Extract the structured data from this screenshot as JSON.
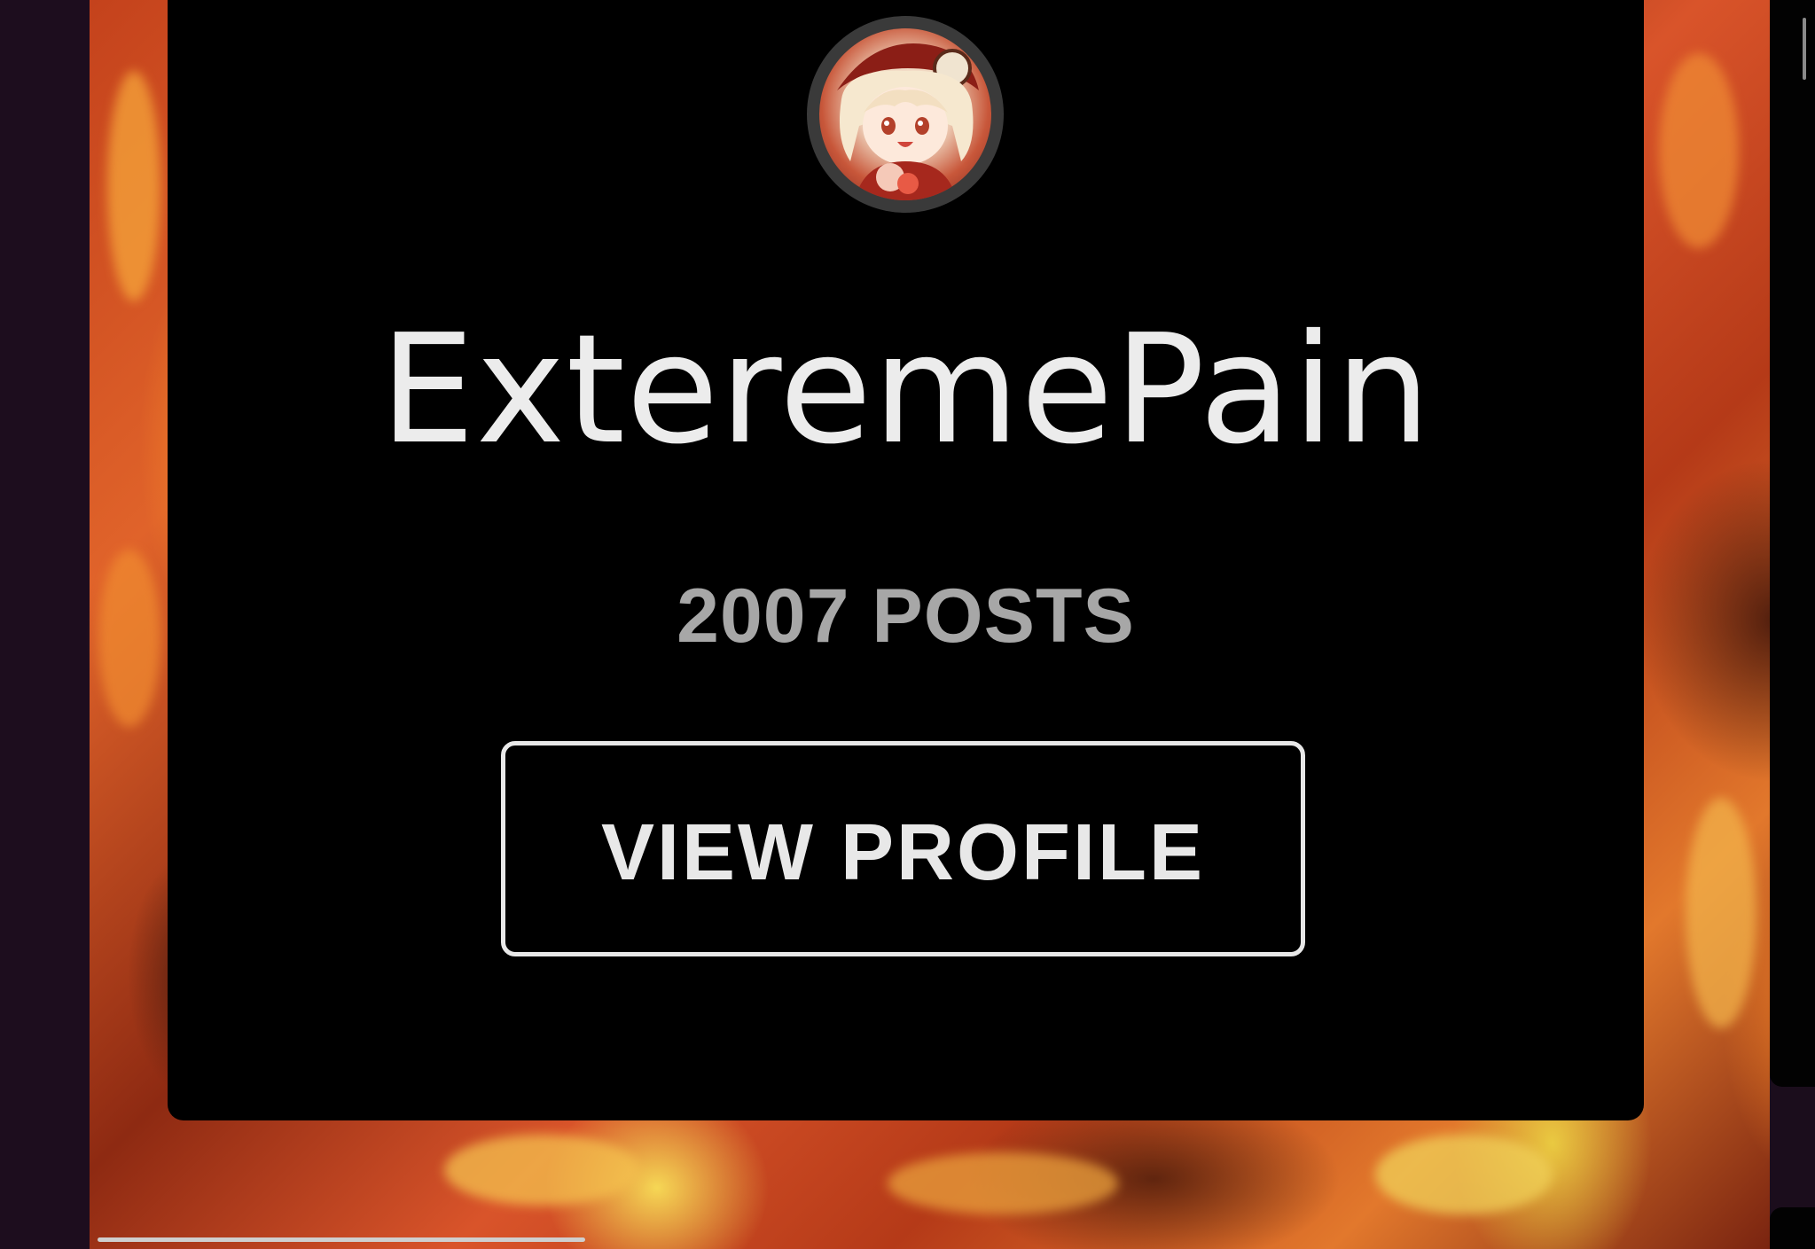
{
  "profile": {
    "username": "ExteremePain",
    "posts_label": "2007 POSTS",
    "view_profile_label": "VIEW PROFILE",
    "avatar_icon": "anime-character-avatar"
  },
  "colors": {
    "card_background": "#000000",
    "text_primary": "#ececec",
    "text_secondary": "#a7a7a7",
    "button_border": "#e8e8e8"
  }
}
